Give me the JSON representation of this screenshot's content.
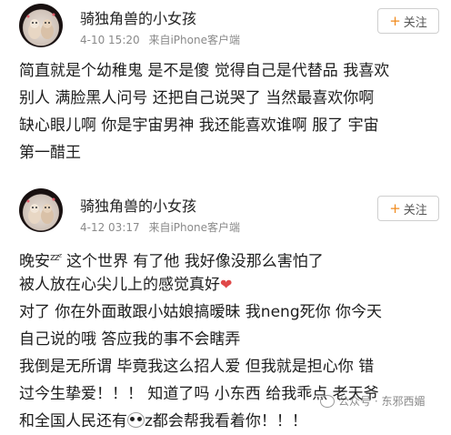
{
  "posts": [
    {
      "username": "骑独角兽的小女孩",
      "date": "4-10 15:20",
      "source": "来自iPhone客户端",
      "follow_label": "关注",
      "lines": [
        "简直就是个幼稚鬼 是不是傻 觉得自己是代替品 我喜欢",
        "别人 满脸黑人问号 还把自己说哭了 当然最喜欢你啊",
        "缺心眼儿啊 你是宇宙男神 我还能喜欢谁啊 服了 宇宙",
        "第一醋王"
      ]
    },
    {
      "username": "骑独角兽的小女孩",
      "date": "4-12 03:17",
      "source": "来自iPhone客户端",
      "follow_label": "关注",
      "line1_start": "晚安",
      "line1_zzz": "zzᶻ",
      "line1_rest": " 这个世界 有了他 我好像没那么害怕了",
      "line2": "被人放在心尖儿上的感觉真好",
      "lines": [
        "对了 你在外面敢跟小姑娘搞暧昧 我neng死你 你今天",
        "自己说的哦 答应我的事不会瞎弄",
        "我倒是无所谓 毕竟我这么招人爱 但我就是担心你 错",
        "过今生挚爱！！！ 知道了吗 小东西 给我乖点 老天爷"
      ],
      "last_start": "和全国人民还有",
      "last_end": "z都会帮我看着你！！！"
    }
  ],
  "watermark": "公众号 · 东邪西媚",
  "icons": [
    "avatar-unicorn-girl",
    "plus-icon",
    "heart-icon",
    "panda-emoji",
    "wechat-icon"
  ]
}
